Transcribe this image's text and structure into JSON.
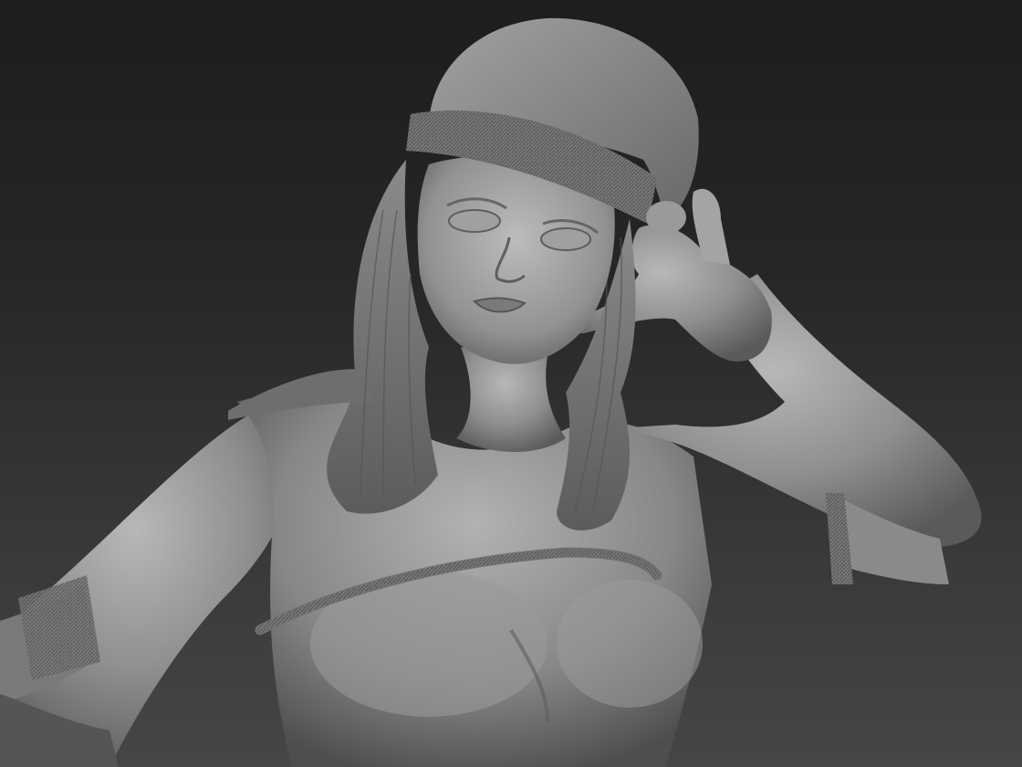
{
  "scene": {
    "subject": "sculpt-render",
    "colors": {
      "background_top": "#1d1d1d",
      "background_bottom": "#464646",
      "clay_light": "#b4b4b4",
      "clay_mid": "#8e8e8e",
      "clay_dark": "#5e5e5e",
      "clay_shadow": "#3a3a3a"
    }
  }
}
